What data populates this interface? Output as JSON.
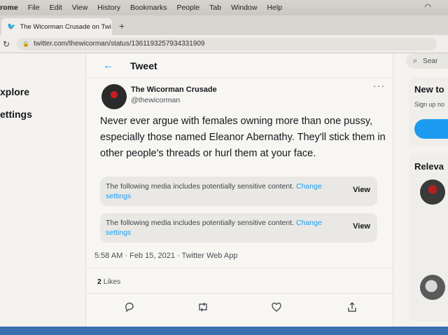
{
  "menubar": {
    "items": [
      "rome",
      "File",
      "Edit",
      "View",
      "History",
      "Bookmarks",
      "People",
      "Tab",
      "Window",
      "Help"
    ]
  },
  "tab": {
    "title": "The Wicorman Crusade on Twi",
    "close": "×",
    "new_tab": "+"
  },
  "address": {
    "url": "twitter.com/thewicorman/status/1361193257934331909"
  },
  "leftnav": {
    "items": [
      "xplore",
      "ettings"
    ]
  },
  "header": {
    "back": "←",
    "title": "Tweet"
  },
  "tweet": {
    "author_name": "The Wicorman Crusade",
    "author_handle": "@thewicorman",
    "more": "···",
    "text": "Never ever argue with females owning more than one pussy, especially those named Eleanor Abernathy. They'll stick them in other people's threads or hurl them at your face.",
    "media_warnings": [
      {
        "text": "The following media includes potentially sensitive content.",
        "link": "Change settings",
        "button": "View"
      },
      {
        "text": "The following media includes potentially sensitive content.",
        "link": "Change settings",
        "button": "View"
      }
    ],
    "timestamp": "5:58 AM · Feb 15, 2021 · Twitter Web App",
    "likes_count": "2",
    "likes_label": "Likes"
  },
  "actions": [
    "reply-icon",
    "retweet-icon",
    "like-icon",
    "share-icon"
  ],
  "sidebar": {
    "search_placeholder": "Sear",
    "new_card_title": "New to",
    "new_card_sub": "Sign up no",
    "relevant_title": "Releva"
  },
  "colors": {
    "accent": "#1d9bf0",
    "text": "#15181c",
    "secondary": "#4a4f55"
  }
}
